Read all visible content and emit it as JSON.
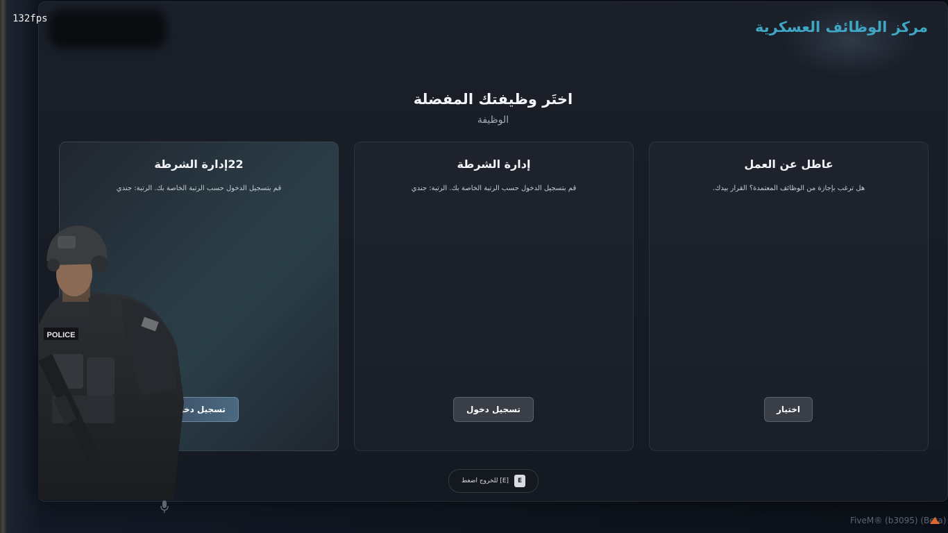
{
  "overlay": {
    "fps": "132fps",
    "build": "FiveM® (b3095) (Beta)"
  },
  "app": {
    "title": "مركز الوظائف العسكرية",
    "heading": "اختَر وظيفتك المفضلة",
    "subheading": "الوظيفة"
  },
  "cards": [
    {
      "title": "عاطل عن العمل",
      "description": "هل ترغب بإجازة من الوظائف المعتمدة؟ القرار بيدك.",
      "button": "اختيار",
      "active": false
    },
    {
      "title": "إدارة الشرطة",
      "description": "قم بتسجيل الدخول حسب الرتبة الخاصة بك. الرتبة: جندي",
      "button": "تسجيل دخول",
      "active": false
    },
    {
      "title": "22إدارة الشرطة",
      "description": "قم بتسجيل الدخول حسب الرتبة الخاصة بك. الرتبة: جندي",
      "button": "تسجيل دخول",
      "active": true
    }
  ],
  "hint": {
    "key": "E",
    "text": "[E] للخروج اضغط"
  },
  "soldier": {
    "vest_label": "POLICE"
  },
  "colors": {
    "accent": "#3fa6c3",
    "panel": "#181c25",
    "active_button": "#4a6a80"
  },
  "icons": {
    "mic": "microphone-icon",
    "fivem": "fivem-logo-icon"
  }
}
